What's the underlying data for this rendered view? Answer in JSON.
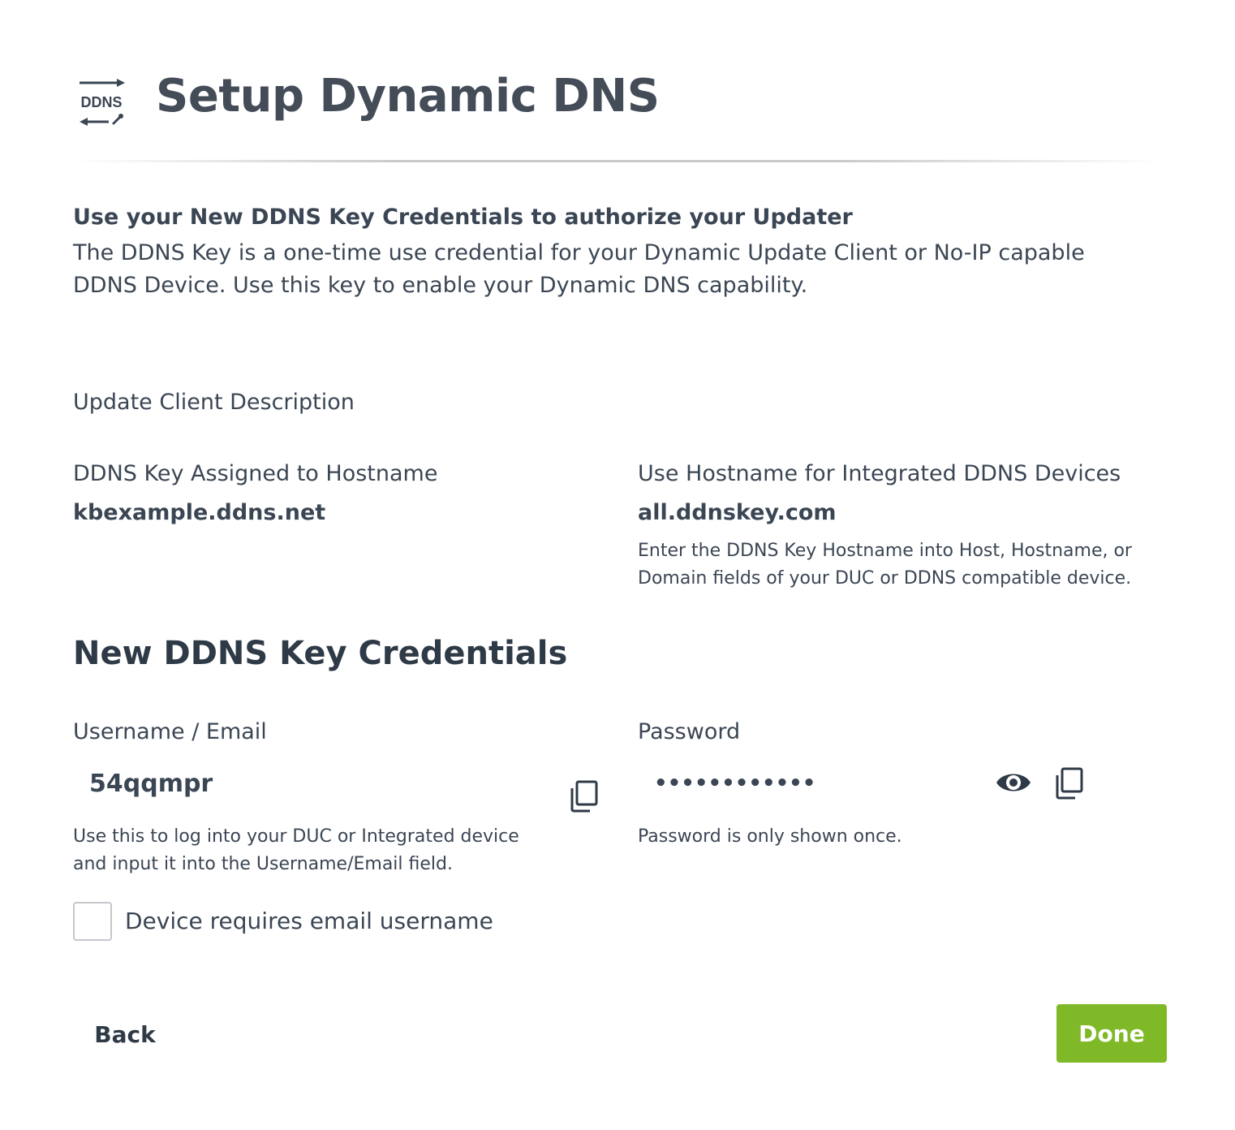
{
  "header": {
    "logo_text": "DDNS",
    "title": "Setup Dynamic DNS"
  },
  "intro": {
    "heading": "Use your New DDNS Key Credentials to authorize your Updater",
    "text": "The DDNS Key is a one-time use credential for your Dynamic Update Client or No-IP capable DDNS Device. Use this key to enable your Dynamic DNS capability."
  },
  "client": {
    "description_label": "Update Client Description",
    "hostname_label": "DDNS Key Assigned to Hostname",
    "hostname_value": "kbexample.ddns.net",
    "integrated_label": "Use Hostname for Integrated DDNS Devices",
    "integrated_value": "all.ddnskey.com",
    "integrated_help": "Enter the DDNS Key Hostname into Host, Hostname, or Domain fields of your DUC or DDNS compatible device."
  },
  "credentials": {
    "heading": "New DDNS Key Credentials",
    "username_label": "Username / Email",
    "username_value": "54qqmpr",
    "username_help": "Use this to log into your DUC or Integrated device and input it into the Username/Email field.",
    "password_label": "Password",
    "password_value": "••••••••••••",
    "password_help": "Password is only shown once.",
    "email_checkbox_label": "Device requires email username"
  },
  "actions": {
    "back_label": "Back",
    "done_label": "Done"
  },
  "colors": {
    "done_button": "#80b928",
    "text": "#3b4654"
  }
}
